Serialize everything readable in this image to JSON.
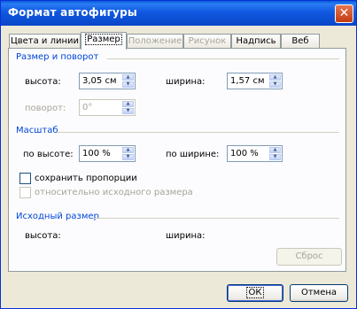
{
  "window": {
    "title": "Формат автофигуры",
    "close_symbol": "✕"
  },
  "tabs": [
    {
      "label": "Цвета и линии",
      "state": "enabled"
    },
    {
      "label": "Размер",
      "state": "active"
    },
    {
      "label": "Положение",
      "state": "disabled"
    },
    {
      "label": "Рисунок",
      "state": "disabled"
    },
    {
      "label": "Надпись",
      "state": "enabled"
    },
    {
      "label": "Веб",
      "state": "enabled"
    }
  ],
  "size_rotate": {
    "heading": "Размер и поворот",
    "height_label": "высота:",
    "height_value": "3,05 см",
    "width_label": "ширина:",
    "width_value": "1,57 см",
    "rotation_label": "поворот:",
    "rotation_value": "0°"
  },
  "scale": {
    "heading": "Масштаб",
    "height_label": "по высоте:",
    "height_value": "100 %",
    "width_label": "по ширине:",
    "width_value": "100 %",
    "lock_aspect_label": "сохранить пропорции",
    "lock_aspect_checked": false,
    "relative_label": "относительно исходного размера",
    "relative_checked": false
  },
  "original_size": {
    "heading": "Исходный размер",
    "height_label": "высота:",
    "width_label": "ширина:",
    "reset_label": "Сброс"
  },
  "footer": {
    "ok_label": "ОК",
    "cancel_label": "Отмена"
  }
}
